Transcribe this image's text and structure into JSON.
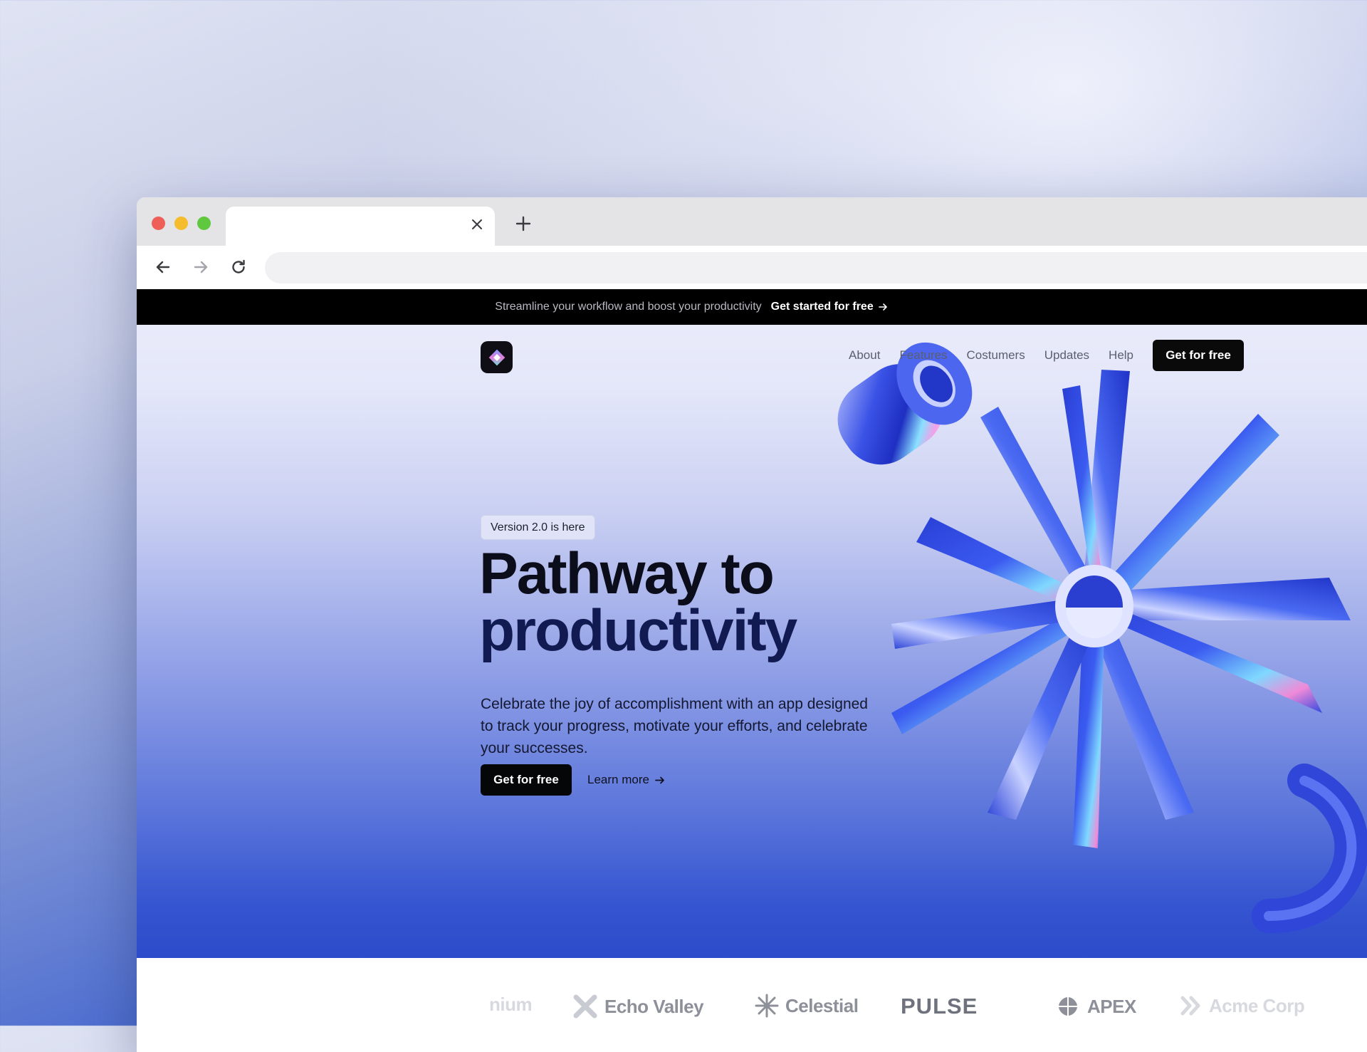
{
  "browser": {
    "tab_title": "",
    "url": ""
  },
  "announcement": {
    "text": "Streamline your workflow and boost your productivity",
    "link_label": "Get started for free"
  },
  "nav": {
    "items": [
      "About",
      "Features",
      "Costumers",
      "Updates",
      "Help"
    ],
    "cta_label": "Get for free"
  },
  "hero": {
    "badge": "Version 2.0 is here",
    "headline_line1": "Pathway to",
    "headline_line2": "productivity",
    "subtext": "Celebrate the joy of accomplishment with an app designed to track your progress, motivate your efforts, and celebrate your successes.",
    "primary_cta": "Get for free",
    "secondary_cta": "Learn more"
  },
  "logo_cloud": {
    "brands": [
      "Echo Valley",
      "Celestial",
      "PULSE",
      "APEX"
    ],
    "partial_left": "nium",
    "partial_right": "Acme Corp"
  },
  "colors": {
    "accent_blue": "#2b4bcb",
    "cta_black": "#050608",
    "announcement_bg": "#000000"
  },
  "icons": [
    "close-icon",
    "plus-icon",
    "back-arrow-icon",
    "forward-arrow-icon",
    "reload-icon",
    "arrow-right-icon",
    "diamond-logo-icon",
    "sparkle-icon",
    "x-shape-icon",
    "blob-icon",
    "chevron-double-icon"
  ]
}
